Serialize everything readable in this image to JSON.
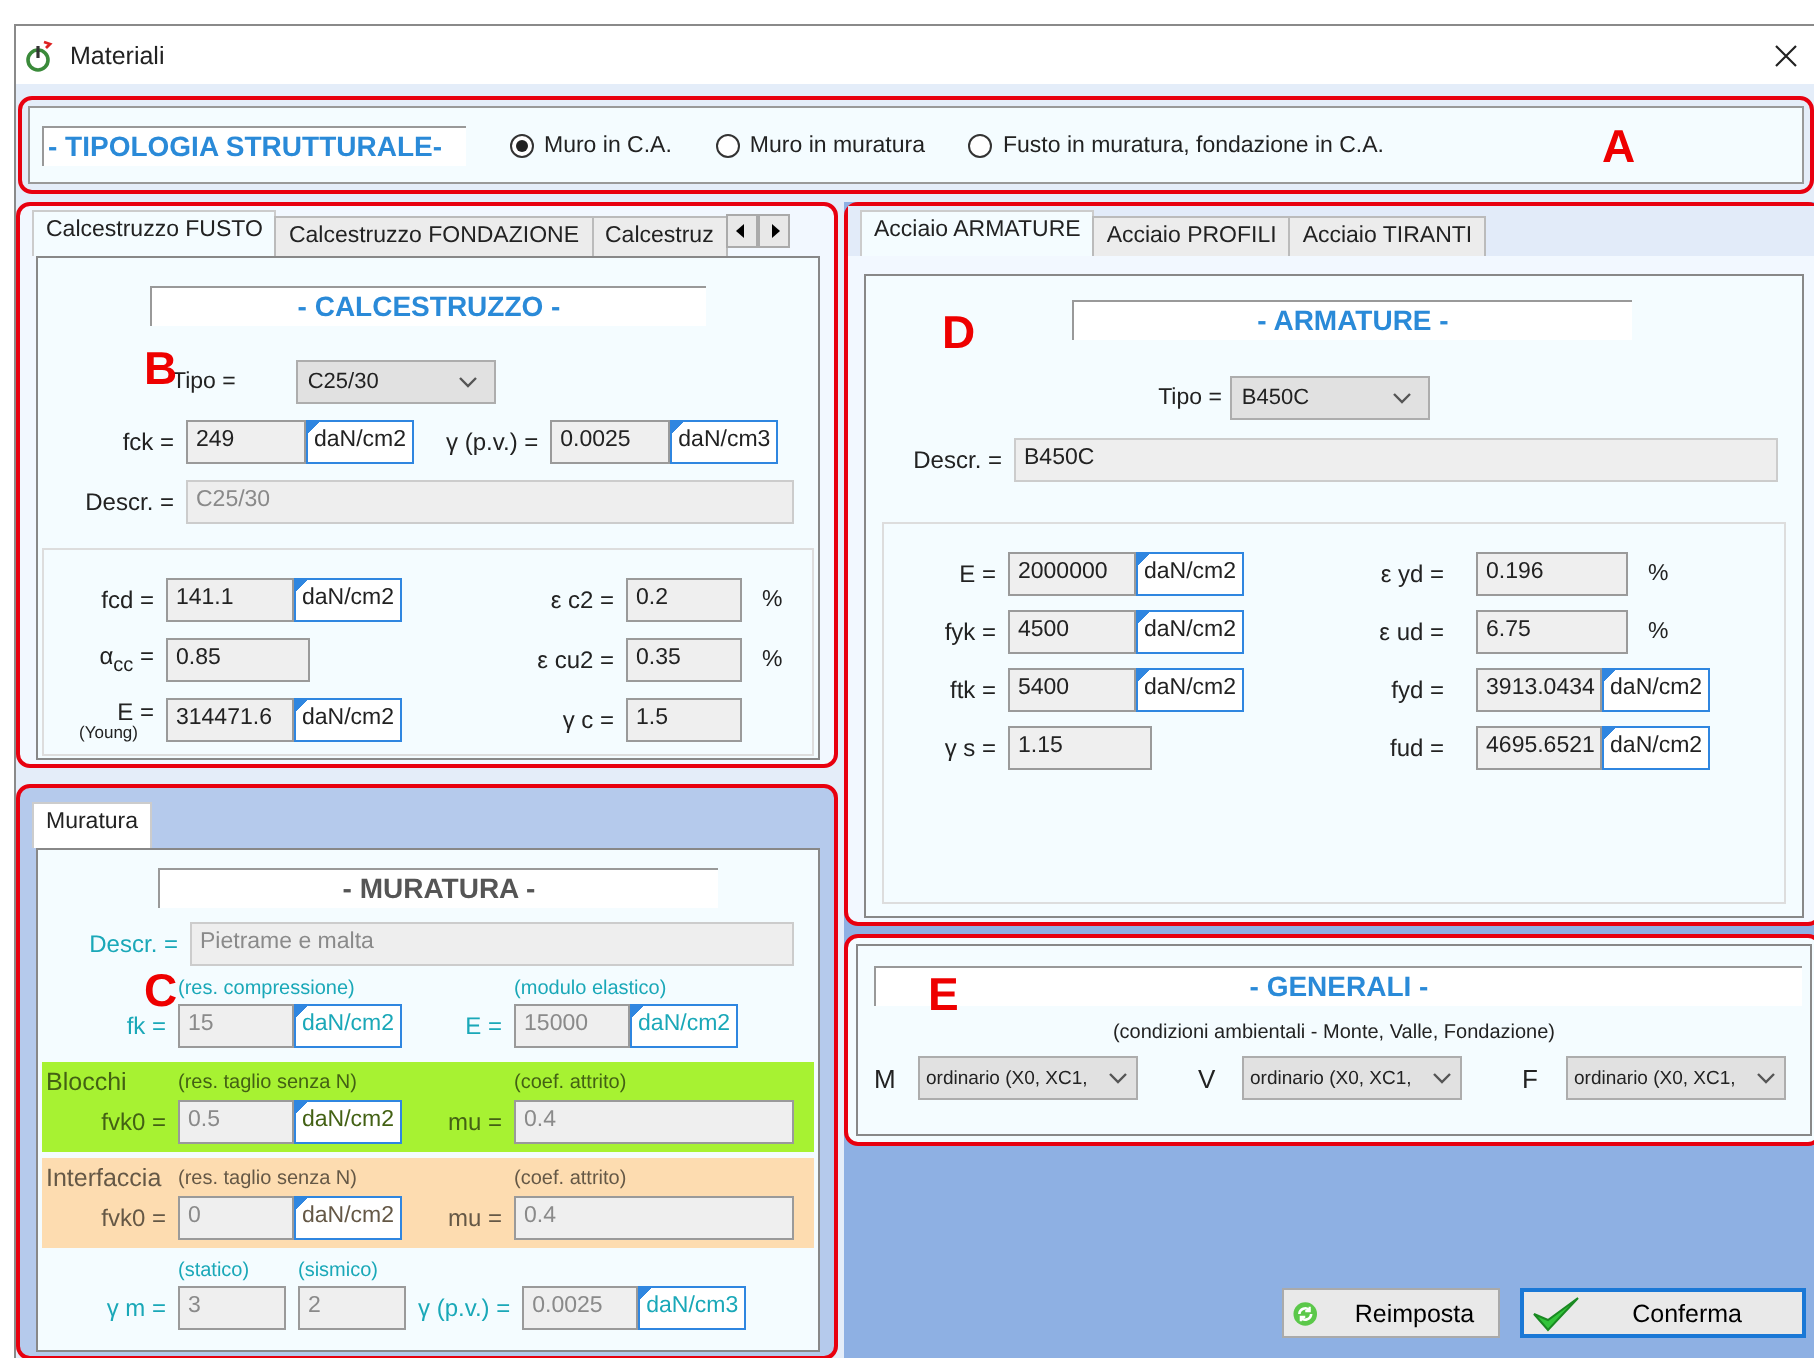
{
  "window": {
    "title": "Materiali"
  },
  "tipologia": {
    "marker": "A",
    "heading": "- TIPOLOGIA STRUTTURALE-",
    "options": [
      {
        "label": "Muro in C.A.",
        "selected": true
      },
      {
        "label": "Muro in muratura",
        "selected": false
      },
      {
        "label": "Fusto in muratura, fondazione in C.A.",
        "selected": false
      }
    ]
  },
  "calcestruzzo": {
    "marker": "B",
    "tab_scroll_buttons": true,
    "tabs": [
      {
        "label": "Calcestruzzo FUSTO",
        "selected": true
      },
      {
        "label": "Calcestruzzo FONDAZIONE",
        "selected": false
      },
      {
        "label": "Calcestruz",
        "selected": false
      }
    ],
    "heading": "- CALCESTRUZZO -",
    "tipo": {
      "label": "Tipo =",
      "value": "C25/30"
    },
    "top_fields": [
      {
        "label": "fck =",
        "value": "249",
        "unit": "daN/cm2"
      },
      {
        "label": "γ  (p.v.) =",
        "value": "0.0025",
        "unit": "daN/cm3"
      }
    ],
    "descr": {
      "label": "Descr. =",
      "value": "C25/30",
      "disabled": true
    },
    "left_fields": [
      {
        "label": "fcd =",
        "value": "141.1",
        "unit": "daN/cm2"
      },
      {
        "label": "α$_{cc}$ =",
        "value": "0.85"
      },
      {
        "label": "E =",
        "sublabel": "(Young)",
        "value": "314471.6",
        "unit": "daN/cm2"
      }
    ],
    "right_fields": [
      {
        "label": "ε  c2 =",
        "value": "0.2",
        "suffix": "%"
      },
      {
        "label": "ε  cu2 =",
        "value": "0.35",
        "suffix": "%"
      },
      {
        "label": "γ  c =",
        "value": "1.5"
      }
    ]
  },
  "muratura": {
    "marker": "C",
    "tabs": [
      {
        "label": "Muratura",
        "selected": true
      }
    ],
    "heading": "- MURATURA -",
    "descr": {
      "label": "Descr. =",
      "value": "Pietrame e malta",
      "disabled": true
    },
    "rows": [
      {
        "kind": "plain",
        "fields": [
          {
            "label": "fk =",
            "hint": "(res. compressione)",
            "value": "15",
            "unit": "daN/cm2",
            "disabled": true
          },
          {
            "label": "E =",
            "hint": "(modulo elastico)",
            "value": "15000",
            "unit": "daN/cm2",
            "disabled": true
          }
        ]
      },
      {
        "kind": "band",
        "title": "Blocchi",
        "color": "#a7f232",
        "fields": [
          {
            "label": "fvk0 =",
            "hint": "(res. taglio senza N)",
            "value": "0.5",
            "unit": "daN/cm2",
            "disabled": true
          },
          {
            "label": "mu =",
            "hint": "(coef. attrito)",
            "value": "0.4",
            "disabled": true
          }
        ]
      },
      {
        "kind": "band",
        "title": "Interfaccia",
        "color": "#fddcb0",
        "fields": [
          {
            "label": "fvk0 =",
            "hint": "(res. taglio senza N)",
            "value": "0",
            "unit": "daN/cm2",
            "disabled": true
          },
          {
            "label": "mu =",
            "hint": "(coef. attrito)",
            "value": "0.4",
            "disabled": true
          }
        ]
      },
      {
        "kind": "plain",
        "fields": [
          {
            "label": "γ  m =",
            "hint": "(statico)",
            "value": "3",
            "disabled": true
          },
          {
            "hint": "(sismico)",
            "value": "2",
            "disabled": true
          },
          {
            "label": "γ  (p.v.) =",
            "value": "0.0025",
            "unit": "daN/cm3",
            "disabled": true
          }
        ]
      }
    ]
  },
  "acciaio": {
    "marker": "D",
    "tabs": [
      {
        "label": "Acciaio ARMATURE",
        "selected": true
      },
      {
        "label": "Acciaio PROFILI",
        "selected": false
      },
      {
        "label": "Acciaio TIRANTI",
        "selected": false
      }
    ],
    "heading": "- ARMATURE -",
    "tipo": {
      "label": "Tipo =",
      "value": "B450C"
    },
    "descr": {
      "label": "Descr. =",
      "value": "B450C",
      "disabled": false
    },
    "left_fields": [
      {
        "label": "E =",
        "value": "2000000",
        "unit": "daN/cm2"
      },
      {
        "label": "fyk =",
        "value": "4500",
        "unit": "daN/cm2"
      },
      {
        "label": "ftk =",
        "value": "5400",
        "unit": "daN/cm2"
      },
      {
        "label": "γ  s =",
        "value": "1.15"
      }
    ],
    "right_fields": [
      {
        "label": "ε  yd =",
        "value": "0.196",
        "suffix": "%"
      },
      {
        "label": "ε  ud =",
        "value": "6.75",
        "suffix": "%"
      },
      {
        "label": "fyd =",
        "value": "3913.0434",
        "unit": "daN/cm2"
      },
      {
        "label": "fud =",
        "value": "4695.6521",
        "unit": "daN/cm2"
      }
    ]
  },
  "generali": {
    "marker": "E",
    "heading": "- GENERALI -",
    "note": "(condizioni ambientali - Monte, Valle, Fondazione)",
    "selects": [
      {
        "label": "M",
        "value": "ordinario (X0, XC1,"
      },
      {
        "label": "V",
        "value": "ordinario (X0, XC1,"
      },
      {
        "label": "F",
        "value": "ordinario (X0, XC1,"
      }
    ]
  },
  "buttons": [
    {
      "label": "Reimposta",
      "kind": "reset"
    },
    {
      "label": "Conferma",
      "kind": "confirm"
    }
  ]
}
